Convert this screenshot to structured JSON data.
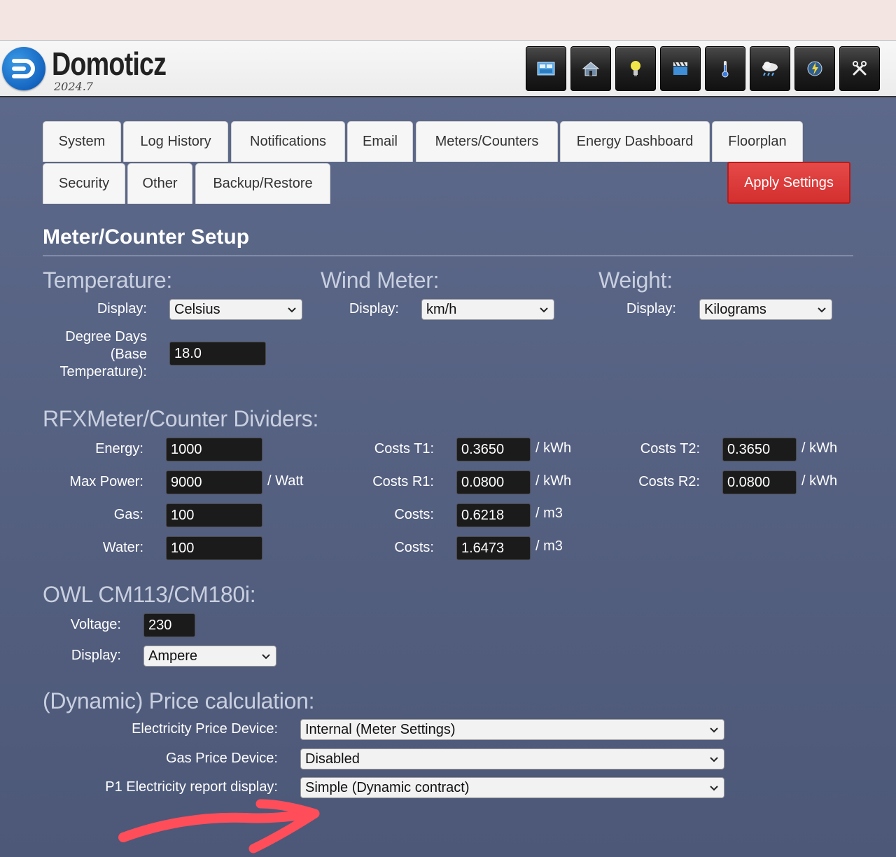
{
  "app": {
    "name": "Domoticz",
    "version": "2024.7"
  },
  "nav_icons": [
    "dashboard-icon",
    "rooms-icon",
    "lightbulb-icon",
    "scenes-icon",
    "thermometer-icon",
    "weather-icon",
    "utility-icon",
    "setup-tools-icon"
  ],
  "tabs_row1": [
    "System",
    "Log History",
    "Notifications",
    "Email",
    "Meters/Counters",
    "Energy Dashboard",
    "Floorplan"
  ],
  "tabs_row2": [
    "Security",
    "Other",
    "Backup/Restore"
  ],
  "apply_label": "Apply Settings",
  "section_title": "Meter/Counter Setup",
  "temperature": {
    "title": "Temperature:",
    "display_label": "Display:",
    "display_value": "Celsius",
    "degree_days_label": [
      "Degree Days",
      "(Base",
      "Temperature):"
    ],
    "degree_days_value": "18.0"
  },
  "wind": {
    "title": "Wind Meter:",
    "display_label": "Display:",
    "display_value": "km/h"
  },
  "weight": {
    "title": "Weight:",
    "display_label": "Display:",
    "display_value": "Kilograms"
  },
  "rfx": {
    "title": "RFXMeter/Counter Dividers:",
    "energy_label": "Energy:",
    "energy_value": "1000",
    "maxpower_label": "Max Power:",
    "maxpower_value": "9000",
    "maxpower_unit": "/ Watt",
    "gas_label": "Gas:",
    "gas_value": "100",
    "water_label": "Water:",
    "water_value": "100",
    "costs_t1_label": "Costs T1:",
    "costs_t1_value": "0.3650",
    "costs_t1_unit": "/ kWh",
    "costs_r1_label": "Costs R1:",
    "costs_r1_value": "0.0800",
    "costs_r1_unit": "/ kWh",
    "costs_gas_label": "Costs:",
    "costs_gas_value": "0.6218",
    "costs_gas_unit": "/ m3",
    "costs_water_label": "Costs:",
    "costs_water_value": "1.6473",
    "costs_water_unit": "/ m3",
    "costs_t2_label": "Costs T2:",
    "costs_t2_value": "0.3650",
    "costs_t2_unit": "/ kWh",
    "costs_r2_label": "Costs R2:",
    "costs_r2_value": "0.0800",
    "costs_r2_unit": "/ kWh"
  },
  "owl": {
    "title": "OWL CM113/CM180i:",
    "voltage_label": "Voltage:",
    "voltage_value": "230",
    "display_label": "Display:",
    "display_value": "Ampere"
  },
  "price": {
    "title": "(Dynamic) Price calculation:",
    "electricity_label": "Electricity Price Device:",
    "electricity_value": "Internal (Meter Settings)",
    "gas_label": "Gas Price Device:",
    "gas_value": "Disabled",
    "p1_label": "P1 Electricity report display:",
    "p1_value": "Simple (Dynamic contract)"
  },
  "colors": {
    "background": "#56617f",
    "apply": "#d32f2f",
    "annotation": "#ff4d5a"
  }
}
